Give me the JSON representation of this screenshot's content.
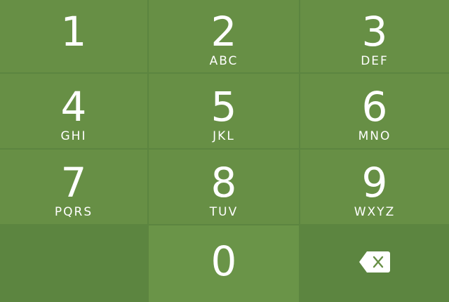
{
  "keypad": {
    "keys": [
      {
        "digit": "1",
        "letters": ""
      },
      {
        "digit": "2",
        "letters": "ABC"
      },
      {
        "digit": "3",
        "letters": "DEF"
      },
      {
        "digit": "4",
        "letters": "GHI"
      },
      {
        "digit": "5",
        "letters": "JKL"
      },
      {
        "digit": "6",
        "letters": "MNO"
      },
      {
        "digit": "7",
        "letters": "PQRS"
      },
      {
        "digit": "8",
        "letters": "TUV"
      },
      {
        "digit": "9",
        "letters": "WXYZ"
      },
      {
        "digit": "0",
        "letters": ""
      }
    ],
    "backspace_icon": "backspace-icon",
    "colors": {
      "key": "#678f45",
      "key_zero": "#6a9448",
      "key_dark": "#5c8540",
      "text": "#ffffff"
    }
  }
}
